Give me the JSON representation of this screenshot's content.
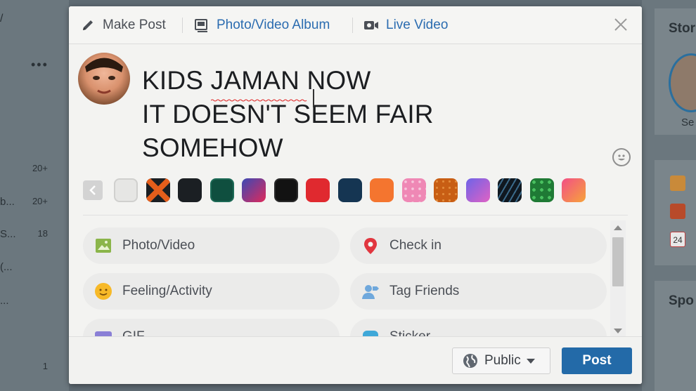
{
  "background": {
    "left_rows": [
      {
        "text": "",
        "count": "20+"
      },
      {
        "text": "b...",
        "count": "20+"
      },
      {
        "text": "S...",
        "count": "18"
      },
      {
        "text": "(...",
        "count": ""
      },
      {
        "text": "...",
        "count": ""
      },
      {
        "text": "",
        "count": "1"
      }
    ],
    "right_stories": "Stor",
    "right_avatar_label": "Se",
    "right_sponsored": "Spo",
    "right_calendar_day": "24"
  },
  "modal": {
    "tabs": [
      {
        "label": "Make Post",
        "icon": "pencil-icon"
      },
      {
        "label": "Photo/Video Album",
        "icon": "album-icon"
      },
      {
        "label": "Live Video",
        "icon": "video-camera-icon"
      }
    ],
    "post_lines": [
      "KIDS JAMAN NOW",
      "IT DOESN'T SEEM FAIR",
      "SOMEHOW"
    ],
    "colors": {
      "link_blue": "#2b6cb0",
      "post_button": "#236aa8",
      "text": "#1c1e21"
    },
    "swatches": [
      {
        "name": "plain-white",
        "color": "#e6e6e4"
      },
      {
        "name": "orange-x-pattern",
        "color": "#e55e1b"
      },
      {
        "name": "black",
        "color": "#1b1f23"
      },
      {
        "name": "dark-green",
        "color": "#0f4f3f"
      },
      {
        "name": "purple-red-gradient",
        "color": "#b33a6e"
      },
      {
        "name": "black-pattern",
        "color": "#121212"
      },
      {
        "name": "red",
        "color": "#e0292f"
      },
      {
        "name": "navy",
        "color": "#153552"
      },
      {
        "name": "orange",
        "color": "#f4752f"
      },
      {
        "name": "pink-pattern",
        "color": "#f39ac1"
      },
      {
        "name": "burnt-orange-pattern",
        "color": "#d2691e"
      },
      {
        "name": "violet-gradient",
        "color": "#b15fd0"
      },
      {
        "name": "dark-stripes",
        "color": "#182430"
      },
      {
        "name": "green-pattern",
        "color": "#2f9e49"
      },
      {
        "name": "pink-orange-gradient",
        "color": "#f26a66"
      }
    ],
    "options": [
      {
        "label": "Photo/Video",
        "icon": "photo-icon"
      },
      {
        "label": "Check in",
        "icon": "location-pin-icon"
      },
      {
        "label": "Feeling/Activity",
        "icon": "smiley-icon"
      },
      {
        "label": "Tag Friends",
        "icon": "tag-friends-icon"
      },
      {
        "label": "GIF",
        "icon": "gif-icon"
      },
      {
        "label": "Sticker",
        "icon": "sticker-icon"
      }
    ],
    "privacy": "Public",
    "post_button": "Post"
  }
}
